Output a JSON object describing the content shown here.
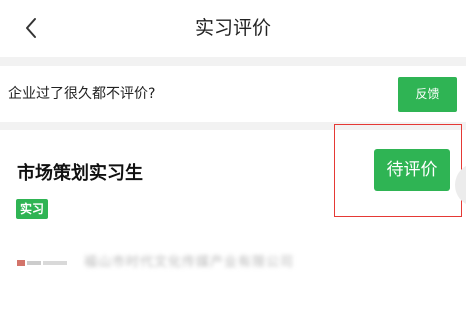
{
  "nav": {
    "back_icon": "chevron-left-icon",
    "title": "实习评价"
  },
  "tip": {
    "text": "企业过了很久都不评价?",
    "feedback_label": "反馈"
  },
  "card": {
    "job_title": "市场策划实习生",
    "tag": "实习",
    "action_label": "待评价",
    "company_name": "福山市时代文化传媒产业有限公司"
  },
  "colors": {
    "accent": "#2fb454",
    "highlight": "#e53935"
  }
}
